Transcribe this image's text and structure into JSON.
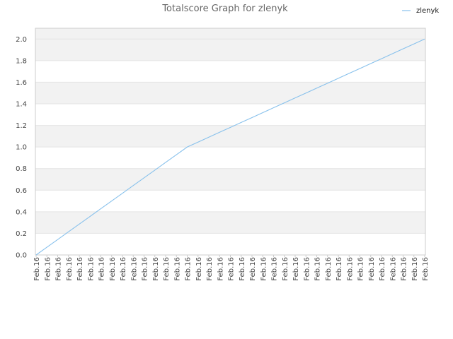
{
  "chart_data": {
    "type": "line",
    "title": "Totalscore Graph for zlenyk",
    "xlabel": "",
    "ylabel": "",
    "x": [
      "Feb.16",
      "Feb.16",
      "Feb.16",
      "Feb.16",
      "Feb.16",
      "Feb.16",
      "Feb.16",
      "Feb.16",
      "Feb.16",
      "Feb.16",
      "Feb.16",
      "Feb.16",
      "Feb.16",
      "Feb.16",
      "Feb.16",
      "Feb.16",
      "Feb.16",
      "Feb.16",
      "Feb.16",
      "Feb.16",
      "Feb.16",
      "Feb.16",
      "Feb.16",
      "Feb.16",
      "Feb.16",
      "Feb.16",
      "Feb.16",
      "Feb.16",
      "Feb.16",
      "Feb.16",
      "Feb.16",
      "Feb.16",
      "Feb.16",
      "Feb.16",
      "Feb.16",
      "Feb.16",
      "Feb.16"
    ],
    "series": [
      {
        "name": "zlenyk",
        "color": "#88c1ec",
        "values": [
          0.0,
          0.07143,
          0.14286,
          0.21429,
          0.28571,
          0.35714,
          0.42857,
          0.5,
          0.57143,
          0.64286,
          0.71429,
          0.78571,
          0.85714,
          0.92857,
          1.0,
          1.04545,
          1.09091,
          1.13636,
          1.18182,
          1.22727,
          1.27273,
          1.31818,
          1.36364,
          1.40909,
          1.45455,
          1.5,
          1.54545,
          1.59091,
          1.63636,
          1.68182,
          1.72727,
          1.77273,
          1.81818,
          1.86364,
          1.90909,
          1.95455,
          2.0
        ]
      }
    ],
    "ylim": [
      0,
      2.1
    ],
    "yticks": [
      "0.0",
      "0.2",
      "0.4",
      "0.6",
      "0.8",
      "1.0",
      "1.2",
      "1.4",
      "1.6",
      "1.8",
      "2.0"
    ],
    "grid": true,
    "legend_position": "top-right",
    "colors": {
      "band": "#f2f2f2",
      "grid": "#e4e4e4",
      "axis": "#cccccc"
    }
  }
}
